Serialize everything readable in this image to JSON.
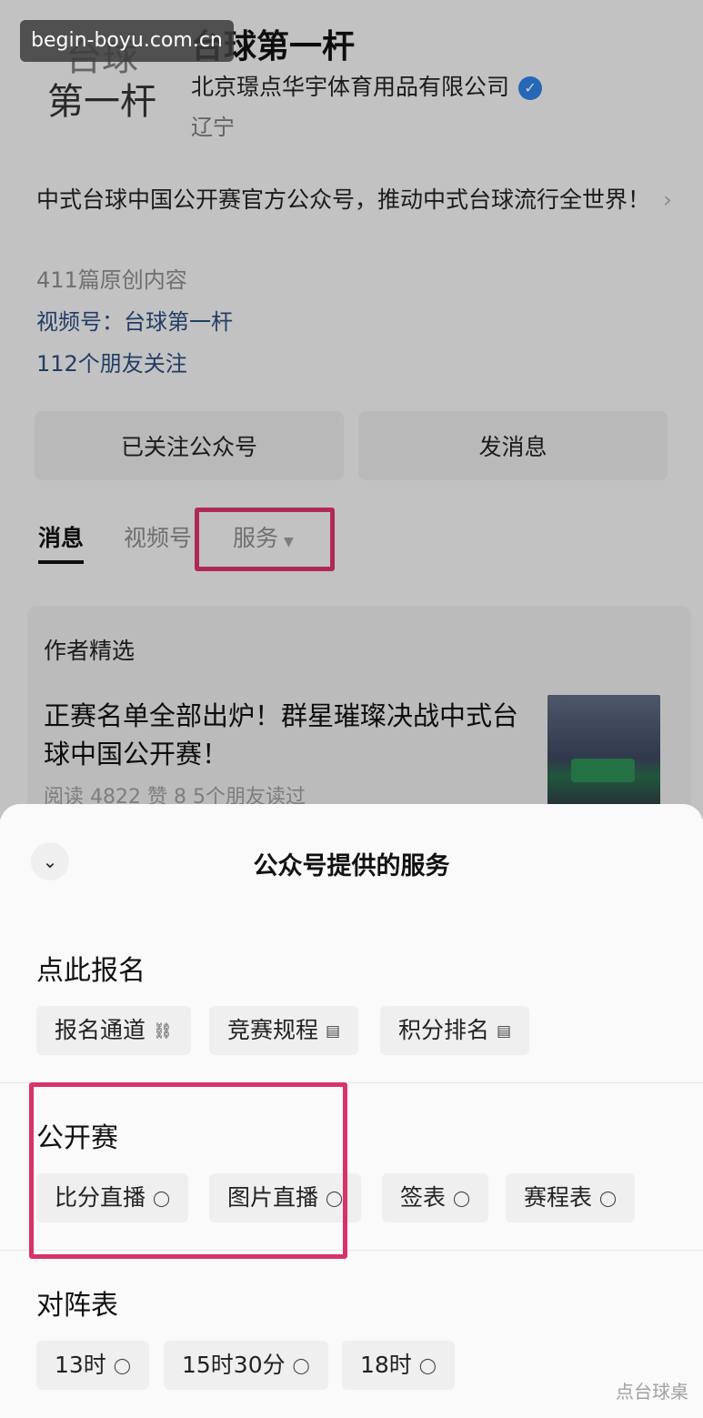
{
  "watermark": "begin-boyu.com.cn",
  "profile": {
    "logo_line1": "台球",
    "logo_line2": "第一杆",
    "name": "台球第一杆",
    "company": "北京璟点华宇体育用品有限公司",
    "verified_icon": "verified-badge-icon",
    "region": "辽宁",
    "description": "中式台球中国公开赛官方公众号，推动中式台球流行全世界！",
    "description_chevron": "›",
    "original_count": "411篇原创内容",
    "video_account": "视频号：台球第一杆",
    "friends": "112个朋友关注"
  },
  "buttons": {
    "follow": "已关注公众号",
    "message": "发消息"
  },
  "tabs": [
    {
      "label": "消息",
      "active": true
    },
    {
      "label": "视频号",
      "active": false
    },
    {
      "label": "服务",
      "active": false
    }
  ],
  "featured": {
    "title": "作者精选",
    "article_title": "正赛名单全部出炉！群星璀璨决战中式台球中国公开赛！",
    "article_meta": "阅读 4822  赞 8  5个朋友读过"
  },
  "sheet": {
    "collapse_icon": "chevron-down-icon",
    "title": "公众号提供的服务",
    "groups": [
      {
        "title": "点此报名",
        "items": [
          {
            "label": "报名通道",
            "icon": "link-icon",
            "glyph": "⛓"
          },
          {
            "label": "竞赛规程",
            "icon": "doc-icon",
            "glyph": "▤"
          },
          {
            "label": "积分排名",
            "icon": "doc-icon",
            "glyph": "▤"
          }
        ]
      },
      {
        "title": "公开赛",
        "items": [
          {
            "label": "比分直播",
            "icon": "chat-icon",
            "glyph": "◯"
          },
          {
            "label": "图片直播",
            "icon": "chat-icon",
            "glyph": "◯"
          },
          {
            "label": "签表",
            "icon": "chat-icon",
            "glyph": "◯"
          },
          {
            "label": "赛程表",
            "icon": "chat-icon",
            "glyph": "◯"
          }
        ]
      },
      {
        "title": "对阵表",
        "items": [
          {
            "label": "13时",
            "icon": "chat-icon",
            "glyph": "◯"
          },
          {
            "label": "15时30分",
            "icon": "chat-icon",
            "glyph": "◯"
          },
          {
            "label": "18时",
            "icon": "chat-icon",
            "glyph": "◯"
          }
        ]
      }
    ]
  },
  "footer_watermark": "点台球桌",
  "colors": {
    "highlight": "#d6336c",
    "link": "#2a4b7c",
    "verified": "#2f7ee0"
  }
}
